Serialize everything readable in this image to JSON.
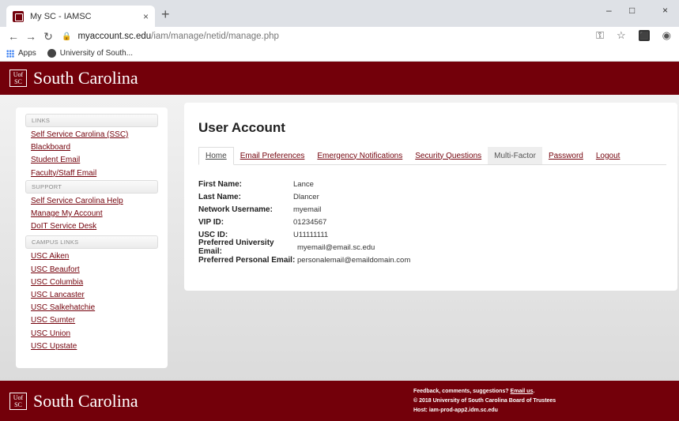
{
  "browser": {
    "tab_title": "My SC - IAMSC",
    "tab_close": "×",
    "new_tab": "+",
    "url_host": "myaccount.sc.edu",
    "url_path": "/iam/manage/netid/manage.php",
    "bookmarks": [
      "Apps",
      "University of South..."
    ],
    "window_controls": [
      "–",
      "□",
      "×"
    ]
  },
  "header": {
    "brand": "South Carolina",
    "logo_text": "UofSC"
  },
  "sidebar": {
    "links_heading": "LINKS",
    "links": [
      "Self Service Carolina (SSC)",
      "Blackboard",
      "Student Email",
      "Faculty/Staff Email"
    ],
    "support_heading": "SUPPORT",
    "support": [
      "Self Service Carolina Help",
      "Manage My Account",
      "DoIT Service Desk"
    ],
    "campus_heading": "CAMPUS LINKS",
    "campus": [
      "USC Aiken",
      "USC Beaufort",
      "USC Columbia",
      "USC Lancaster",
      "USC Salkehatchie",
      "USC Sumter",
      "USC Union",
      "USC Upstate"
    ]
  },
  "main": {
    "title": "User Account",
    "tabs": [
      "Home",
      "Email Preferences",
      "Emergency Notifications",
      "Security Questions",
      "Multi-Factor",
      "Password",
      "Logout"
    ],
    "fields": [
      {
        "label": "First Name:",
        "value": "Lance"
      },
      {
        "label": "Last Name:",
        "value": "Dlancer"
      },
      {
        "label": "Network Username:",
        "value": "myemail"
      },
      {
        "label": "VIP ID:",
        "value": "01234567"
      },
      {
        "label": "USC ID:",
        "value": "U11111111"
      },
      {
        "label": "Preferred University Email:",
        "value": "myemail@email.sc.edu"
      },
      {
        "label": "Preferred Personal Email:",
        "value": "personalemail@emaildomain.com"
      }
    ]
  },
  "footer": {
    "brand": "South Carolina",
    "feedback": "Feedback, comments, suggestions?",
    "email_link": "Email us",
    "copyright": "© 2018 University of South Carolina Board of Trustees",
    "host": "Host: iam-prod-app2.idm.sc.edu"
  }
}
